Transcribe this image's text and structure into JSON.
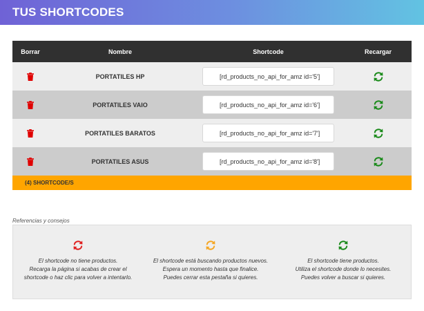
{
  "header": {
    "title": "TUS SHORTCODES"
  },
  "table": {
    "columns": {
      "delete": "Borrar",
      "name": "Nombre",
      "shortcode": "Shortcode",
      "reload": "Recargar"
    },
    "rows": [
      {
        "name": "PORTATILES HP",
        "shortcode": "[rd_products_no_api_for_amz id='5']"
      },
      {
        "name": "PORTATILES VAIO",
        "shortcode": "[rd_products_no_api_for_amz id='6']"
      },
      {
        "name": "PORTATILES BARATOS",
        "shortcode": "[rd_products_no_api_for_amz id='7']"
      },
      {
        "name": "PORTATILES ASUS",
        "shortcode": "[rd_products_no_api_for_amz id='8']"
      }
    ],
    "footer": "(4) SHORTCODE/S"
  },
  "references": {
    "title": "Referencias y consejos",
    "items": [
      {
        "icon": "refresh-icon-red",
        "color": "#e02020",
        "lines": [
          "El shortcode no tiene productos.",
          "Recarga la página si acabas de crear el",
          "shortcode o haz clic para volver a intentarlo."
        ]
      },
      {
        "icon": "refresh-icon-orange",
        "color": "#f5a623",
        "lines": [
          "El shortcode está buscando productos nuevos.",
          "Espera un momento hasta que finalice.",
          "Puedes cerrar esta pestaña si quieres."
        ]
      },
      {
        "icon": "refresh-icon-green",
        "color": "#1a8a1a",
        "lines": [
          "El shortcode tiene productos.",
          "Utiliza el shortcode donde lo necesites.",
          "Puedes volver a buscar si quieres."
        ]
      }
    ]
  },
  "colors": {
    "trash": "#e00000",
    "reload_ok": "#1a8a1a",
    "footer_bar": "#ffa500",
    "header_dark": "#303030"
  }
}
